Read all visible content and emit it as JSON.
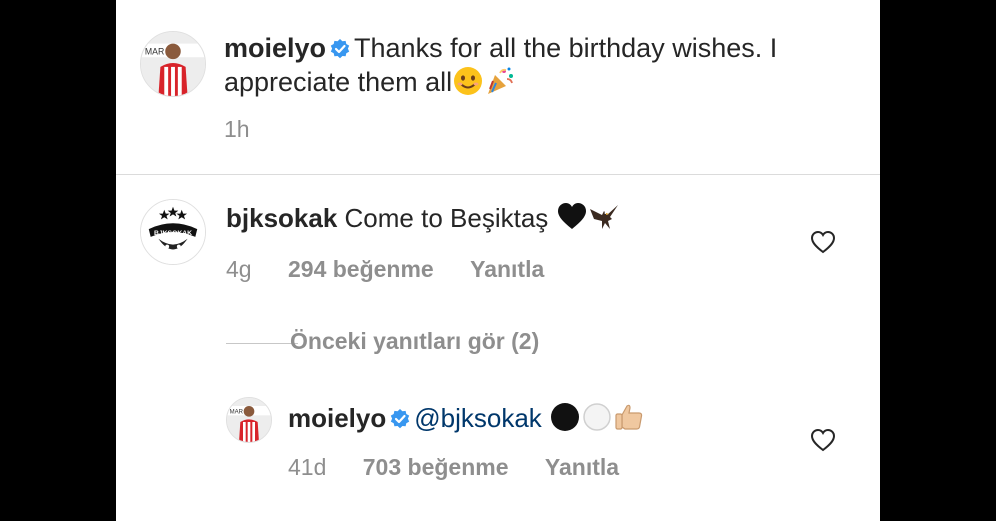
{
  "post": {
    "username": "moielyo",
    "caption": "Thanks for all the birthday wishes. I",
    "caption_line2": "appreciate them all",
    "emojis": [
      "smiling-face-emoji",
      "party-popper-emoji"
    ],
    "time": "1h",
    "avatar_text": "MAR ON"
  },
  "comments": [
    {
      "username": "bjksokak",
      "text": "Come to Beşiktaş",
      "emojis": [
        "black-heart-emoji",
        "eagle-emoji"
      ],
      "time": "4g",
      "likes": "294 beğenme",
      "reply_label": "Yanıtla",
      "avatar_text": "BJKSOKAK"
    }
  ],
  "replies_toggle": "Önceki yanıtları gör (2)",
  "reply": {
    "username": "moielyo",
    "mention": "@bjksokak",
    "emojis": [
      "black-circle-emoji",
      "white-circle-emoji",
      "thumbs-up-emoji"
    ],
    "time": "41d",
    "likes": "703 beğenme",
    "reply_label": "Yanıtla",
    "avatar_text": "MAR ON"
  },
  "colors": {
    "verified_badge": "#3897f0",
    "text": "#262626",
    "secondary_text": "#8e8e8e",
    "mention": "#00376b",
    "background": "#ffffff"
  }
}
